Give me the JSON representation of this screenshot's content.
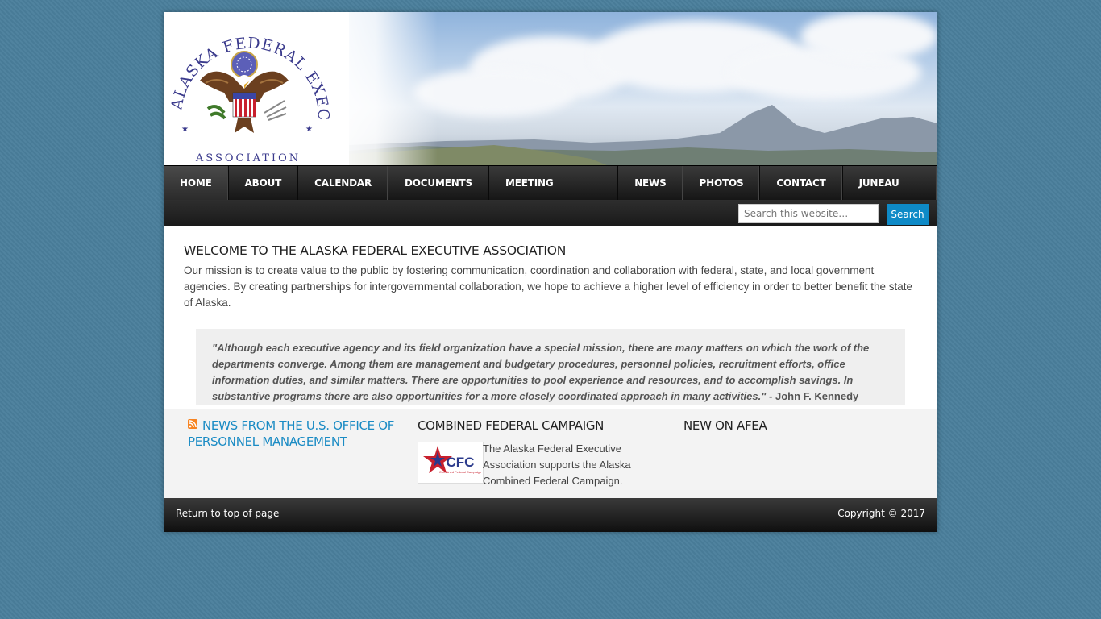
{
  "header": {
    "logo": {
      "arc_text": "ALASKA FEDERAL EXECUTIVE",
      "bottom_text": "ASSOCIATION"
    }
  },
  "nav": {
    "items": [
      {
        "label": "HOME",
        "active": true
      },
      {
        "label": "ABOUT"
      },
      {
        "label": "CALENDAR"
      },
      {
        "label": "DOCUMENTS"
      },
      {
        "label": "MEETING MINUTES"
      },
      {
        "label": "NEWS"
      },
      {
        "label": "PHOTOS"
      },
      {
        "label": "CONTACT"
      },
      {
        "label": "JUNEAU FEA"
      }
    ]
  },
  "search": {
    "placeholder": "Search this website…",
    "button_label": "Search"
  },
  "content": {
    "title": "WELCOME TO THE ALASKA FEDERAL EXECUTIVE ASSOCIATION",
    "mission": "Our mission is to create value to the public by fostering communication, coordination and collaboration with federal, state, and local government agencies. By creating partnerships for intergovernmental collaboration, we hope to achieve a higher level of efficiency in order to better benefit the state of Alaska.",
    "quote": "\"Although each executive agency and its field organization have a special mission, there are many matters on which the work of the departments converge. Among them are management and budgetary procedures, personnel policies, recruitment efforts, office information duties, and similar matters. There are opportunities to pool experience and resources, and to accomplish savings. In substantive programs there are also opportunities for a more closely coordinated approach in many activities.\"",
    "quote_author": " - John F. Kennedy"
  },
  "widgets": {
    "rss": {
      "title": "NEWS FROM THE U.S. OFFICE OF PERSONNEL MANAGEMENT",
      "icon": "rss-icon"
    },
    "cfc": {
      "title": "COMBINED FEDERAL CAMPAIGN",
      "logo_text": "CFC",
      "logo_subtext": "Combined Federal Campaign",
      "text": "The Alaska Federal Executive Association supports the Alaska Combined Federal Campaign."
    },
    "new": {
      "title": "NEW ON AFEA"
    }
  },
  "footer": {
    "back_to_top": "Return to top of page",
    "copyright": "Copyright © 2017"
  },
  "colors": {
    "page_background": "#4a7f9c",
    "accent": "#0e8ac7",
    "link": "#1a8bc4",
    "nav_background": "#1f1f1f"
  }
}
